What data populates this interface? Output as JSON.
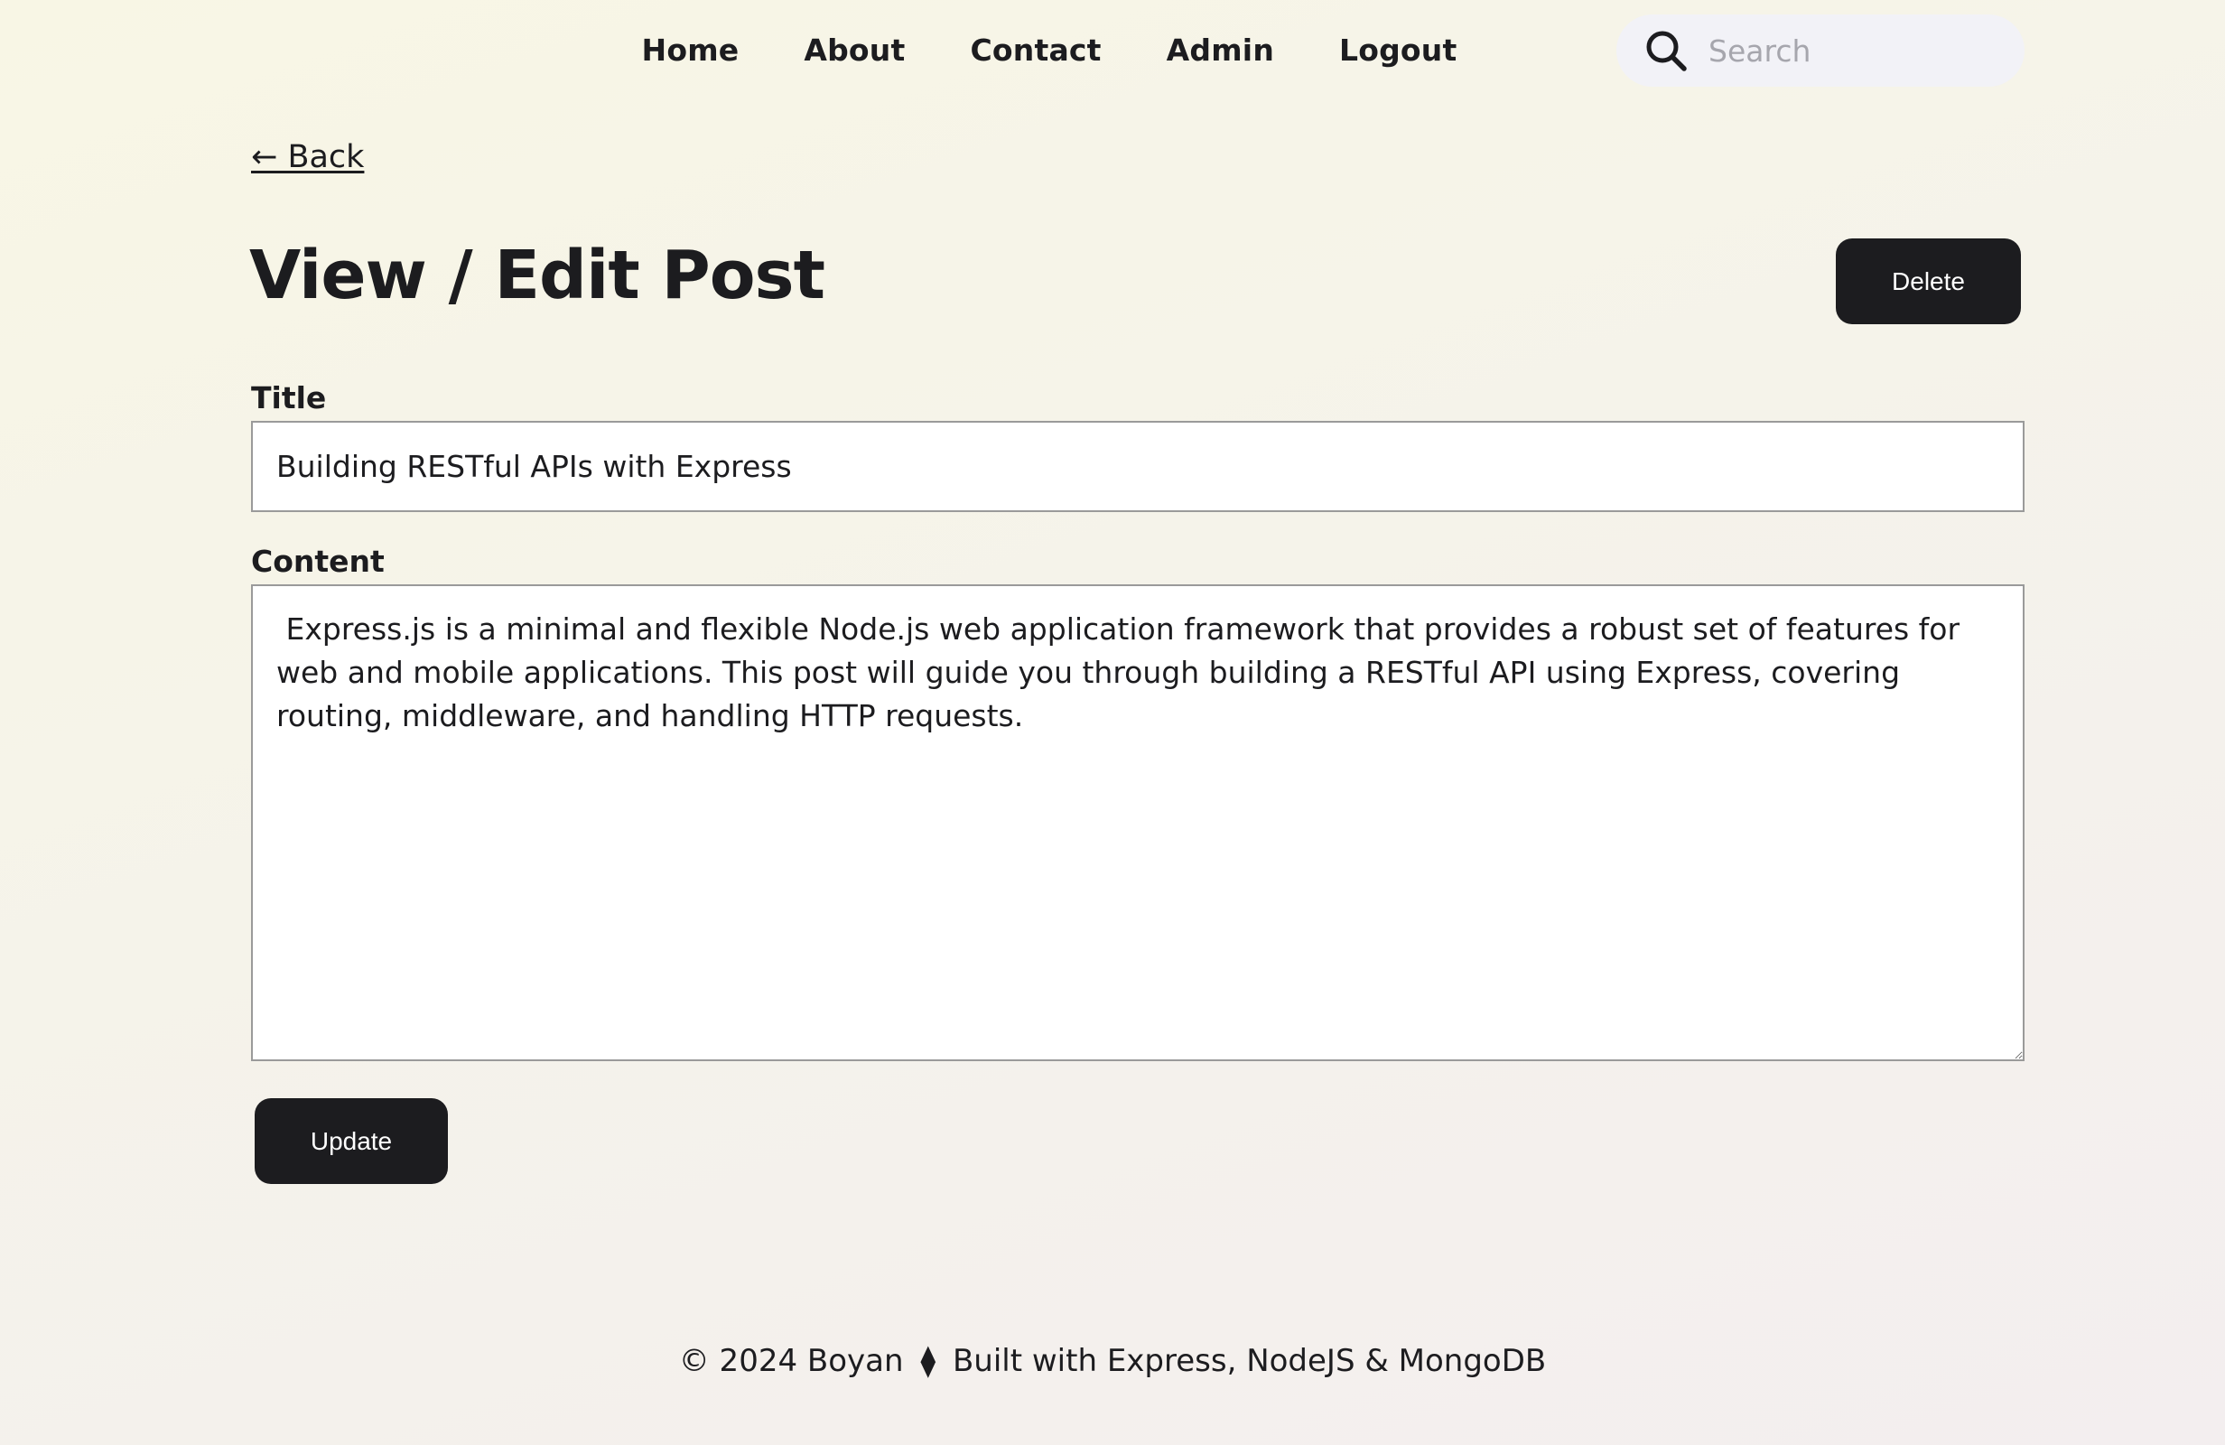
{
  "header": {
    "nav": [
      {
        "label": "Home"
      },
      {
        "label": "About"
      },
      {
        "label": "Contact"
      },
      {
        "label": "Admin"
      },
      {
        "label": "Logout"
      }
    ],
    "search": {
      "placeholder": "Search",
      "value": "",
      "icon": "search-icon"
    }
  },
  "main": {
    "back_label": "← Back",
    "title": "View / Edit Post",
    "delete_label": "Delete",
    "title_field": {
      "label": "Title",
      "value": "Building RESTful APIs with Express"
    },
    "content_field": {
      "label": "Content",
      "value": " Express.js is a minimal and flexible Node.js web application framework that provides a robust set of features for web and mobile applications. This post will guide you through building a RESTful API using Express, covering routing, middleware, and handling HTTP requests."
    },
    "update_label": "Update"
  },
  "footer": {
    "copyright": "© 2024 Boyan",
    "separator": "⧫",
    "built_with": "Built with Express, NodeJS & MongoDB"
  },
  "colors": {
    "primary_dark": "#1c1c1f",
    "search_bg": "#f2f2f7",
    "input_border": "#9a9a9a"
  }
}
